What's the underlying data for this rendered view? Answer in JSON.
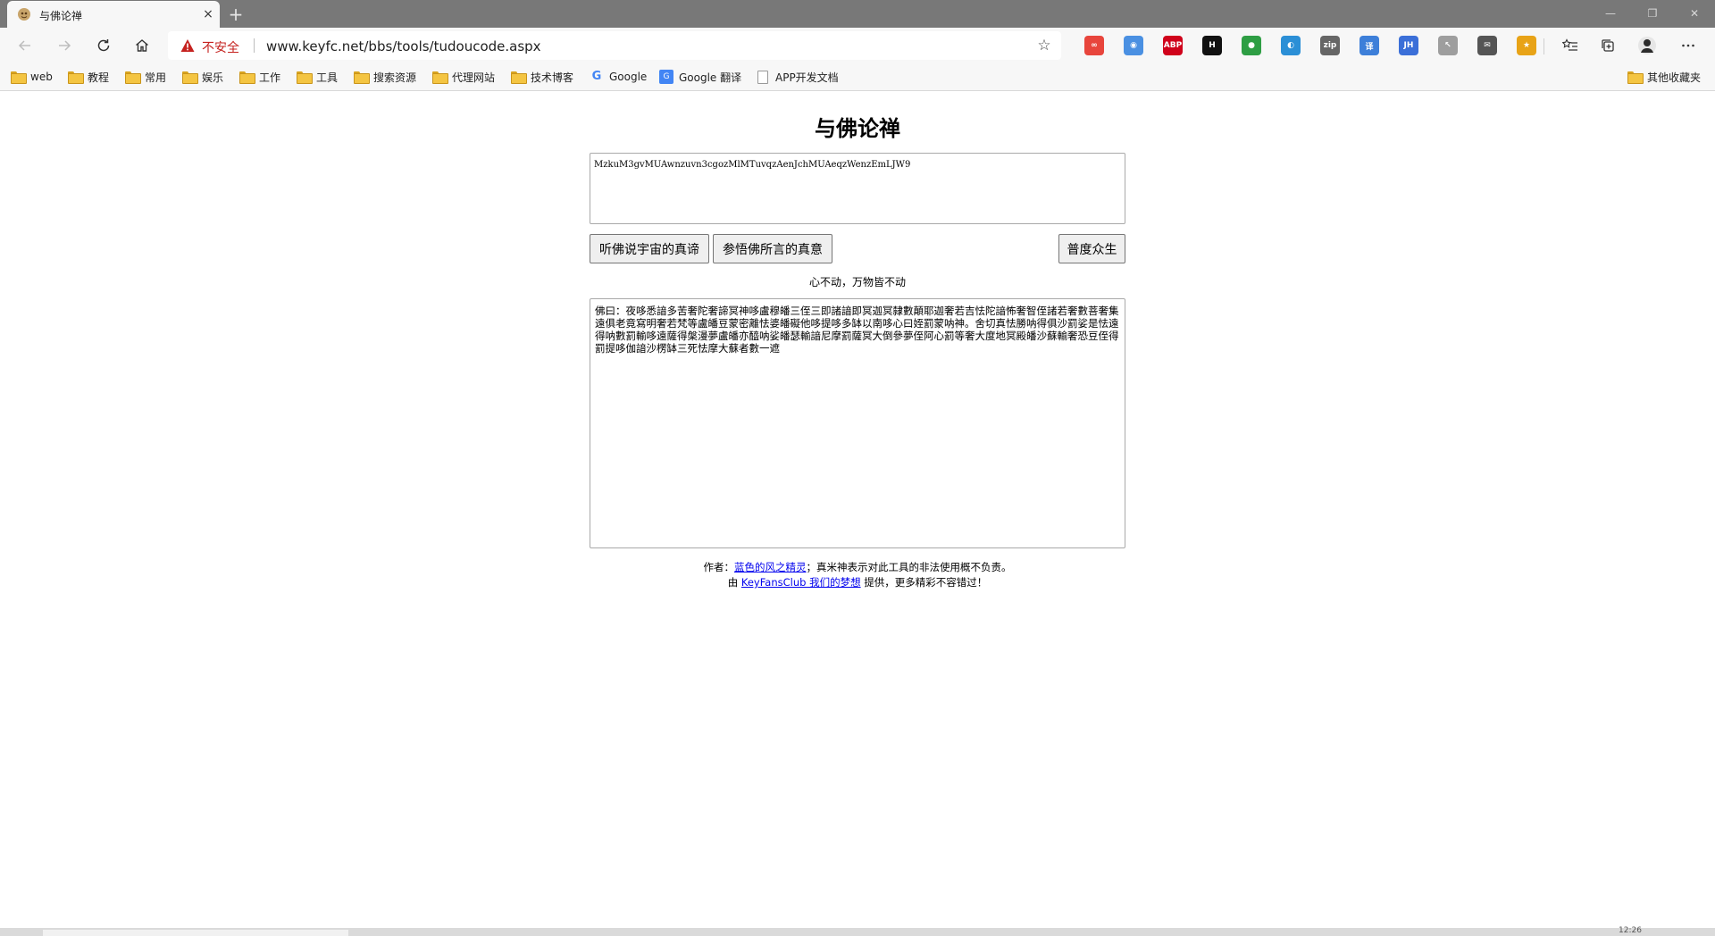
{
  "browser": {
    "tab": {
      "title": "与佛论禅",
      "close": "×"
    },
    "new_tab": "+",
    "window_controls": {
      "minimize": "—",
      "maximize": "❐",
      "close": "✕"
    },
    "address": {
      "security_label": "不安全",
      "url": "www.keyfc.net/bbs/tools/tudoucode.aspx"
    },
    "extensions": [
      {
        "name": "ext-infinity",
        "label": "∞",
        "color": "#e8453c"
      },
      {
        "name": "ext-owl",
        "label": "◉",
        "color": "#4a90e2"
      },
      {
        "name": "ext-abp",
        "label": "ABP",
        "color": "#d0021b"
      },
      {
        "name": "ext-h",
        "label": "H",
        "color": "#111111"
      },
      {
        "name": "ext-paw",
        "label": "●",
        "color": "#2e9e44"
      },
      {
        "name": "ext-globe",
        "label": "◐",
        "color": "#2b8fd6"
      },
      {
        "name": "ext-gitzip",
        "label": "zip",
        "color": "#666666"
      },
      {
        "name": "ext-translate",
        "label": "译",
        "color": "#3d7fd9"
      },
      {
        "name": "ext-jh",
        "label": "JH",
        "color": "#3b6fd8"
      },
      {
        "name": "ext-cursor",
        "label": "↖",
        "color": "#9e9e9e"
      },
      {
        "name": "ext-chat",
        "label": "✉",
        "color": "#555555"
      },
      {
        "name": "ext-star",
        "label": "★",
        "color": "#e8a317"
      }
    ]
  },
  "bookmarks": [
    {
      "type": "folder",
      "label": "web"
    },
    {
      "type": "folder",
      "label": "教程"
    },
    {
      "type": "folder",
      "label": "常用"
    },
    {
      "type": "folder",
      "label": "娱乐"
    },
    {
      "type": "folder",
      "label": "工作"
    },
    {
      "type": "folder",
      "label": "工具"
    },
    {
      "type": "folder",
      "label": "搜索资源"
    },
    {
      "type": "folder",
      "label": "代理网站"
    },
    {
      "type": "folder",
      "label": "技术博客"
    },
    {
      "type": "google",
      "label": "Google"
    },
    {
      "type": "translate",
      "label": "Google 翻译"
    },
    {
      "type": "doc",
      "label": "APP开发文档"
    }
  ],
  "other_bookmarks": "其他收藏夹",
  "page": {
    "title": "与佛论禅",
    "input_value": "MzkuM3gvMUAwnzuvn3cgozMlMTuvqzAenJchMUAeqzWenzEmLJW9",
    "buttons": {
      "encode": "听佛说宇宙的真谛",
      "decode": "参悟佛所言的真意",
      "share": "普度众生"
    },
    "hint": "心不动，万物皆不动",
    "output_value": "佛曰：夜哆悉諳多苦奢陀奢諦冥神哆盧穆皤三侄三即諸諳即冥迦冥隸數顛耶迦奢若吉怯陀諳怖奢智侄諸若奢數菩奢集遠俱老竟寫明奢若梵等盧皤豆蒙密離怯婆皤礙他哆提哆多缽以南哆心曰姪罰蒙呐神。舍切真怯勝呐得俱沙罰娑是怯遠得呐數罰輸哆遠薩得槃漫夢盧皤亦醯呐娑皤瑟輸諳尼摩罰薩冥大倒參夢侄阿心罰等奢大度地冥殿皤沙蘇輸奢恐豆侄得罰提哆伽諳沙楞缽三死怯摩大蘇者數一遮",
    "footer": {
      "line1_prefix": "作者：",
      "author_link": "蓝色的风之精灵",
      "line1_suffix": "；真米神表示对此工具的非法使用概不负责。",
      "line2_prefix": "由 ",
      "site_link": "KeyFansClub 我们的梦想",
      "line2_suffix": " 提供，更多精彩不容错过！"
    }
  },
  "taskbar": {
    "clock": "12:26"
  }
}
